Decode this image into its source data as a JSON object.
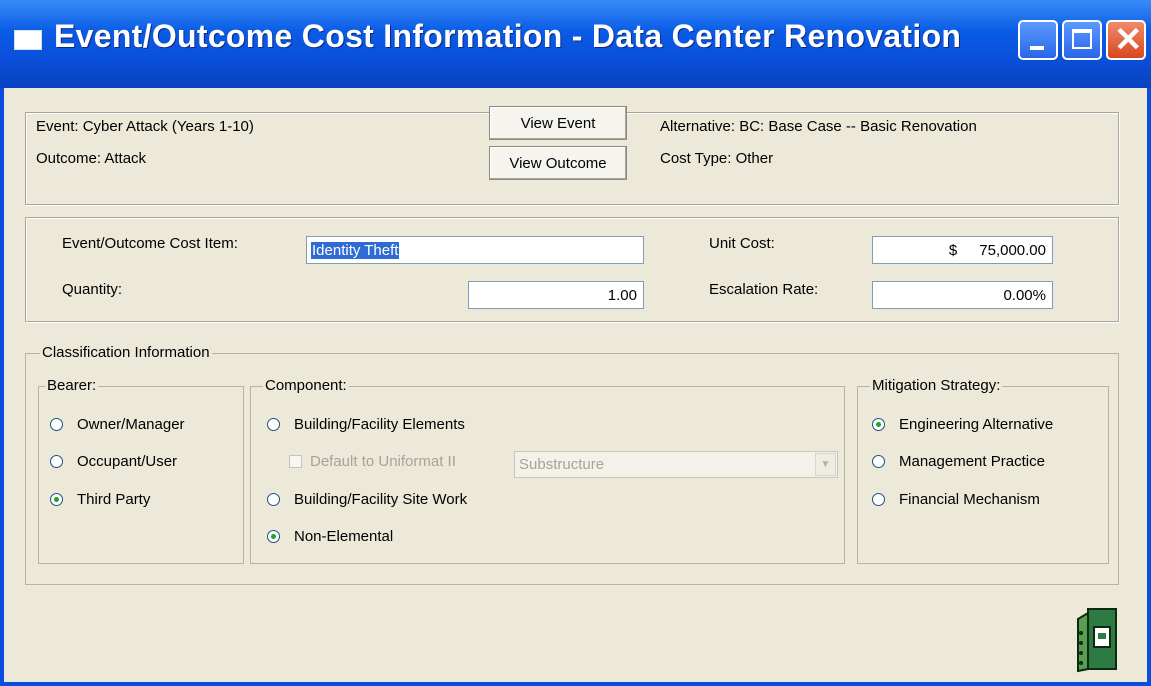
{
  "window": {
    "title": "Event/Outcome Cost Information - Data Center Renovation"
  },
  "header": {
    "event_label": "Event:  Cyber Attack (Years 1-10)",
    "outcome_label": "Outcome:  Attack",
    "view_event_button": "View Event",
    "view_outcome_button": "View Outcome",
    "alternative_label": "Alternative:  BC: Base Case -- Basic Renovation",
    "cost_type_label": "Cost Type:  Other"
  },
  "cost": {
    "item_label": "Event/Outcome Cost Item:",
    "item_value": "Identity Theft",
    "quantity_label": "Quantity:",
    "quantity_value": "1.00",
    "unit_cost_label": "Unit Cost:",
    "unit_cost_currency": "$",
    "unit_cost_value": "75,000.00",
    "escalation_label": "Escalation Rate:",
    "escalation_value": "0.00%"
  },
  "classification": {
    "title": "Classification Information",
    "bearer": {
      "title": "Bearer:",
      "options": [
        "Owner/Manager",
        "Occupant/User",
        "Third Party"
      ],
      "selected": "Third Party"
    },
    "component": {
      "title": "Component:",
      "options": [
        "Building/Facility Elements",
        "Building/Facility Site Work",
        "Non-Elemental"
      ],
      "default_checkbox": "Default to Uniformat II",
      "dropdown_value": "Substructure",
      "selected": "Non-Elemental"
    },
    "mitigation": {
      "title": "Mitigation Strategy:",
      "options": [
        "Engineering Alternative",
        "Management Practice",
        "Financial Mechanism"
      ],
      "selected": "Engineering Alternative"
    }
  },
  "colors": {
    "titlebar": "#0a4ed8",
    "window_bg": "#ece9d8",
    "selection": "#2f6bd4",
    "radio_dot": "#21a121"
  }
}
